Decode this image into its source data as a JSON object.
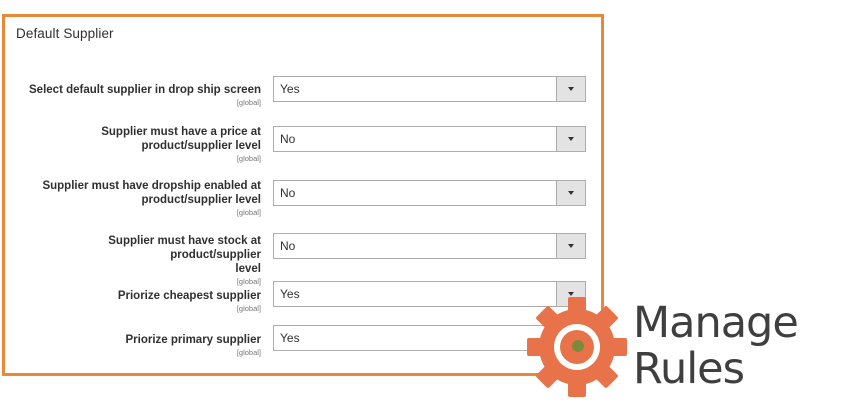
{
  "section": {
    "title": "Default Supplier"
  },
  "fields": [
    {
      "label_lines": [
        "Select default supplier in drop ship screen"
      ],
      "scope": "[global]",
      "value": "Yes"
    },
    {
      "label_lines": [
        "Supplier must have a price at",
        "product/supplier level"
      ],
      "scope": "[global]",
      "value": "No"
    },
    {
      "label_lines": [
        "Supplier must have dropship enabled at",
        "product/supplier level"
      ],
      "scope": "[global]",
      "value": "No"
    },
    {
      "label_lines": [
        "Supplier must have stock at product/supplier",
        "level"
      ],
      "scope": "[global]",
      "value": "No"
    },
    {
      "label_lines": [
        "Priorize cheapest supplier"
      ],
      "scope": "[global]",
      "value": "Yes"
    },
    {
      "label_lines": [
        "Priorize primary supplier"
      ],
      "scope": "[global]",
      "value": "Yes"
    }
  ],
  "logo": {
    "line1": "Manage",
    "line2": "Rules",
    "icon": "gear-icon",
    "colors": {
      "gear": "#e8734a",
      "gear_inner": "#ffffff",
      "center": "#7a8a3a",
      "text": "#3f3f3f"
    }
  },
  "colors": {
    "panel_border": "#e8893a",
    "dropdown_button": "#e3e3e3",
    "text": "#303030"
  }
}
